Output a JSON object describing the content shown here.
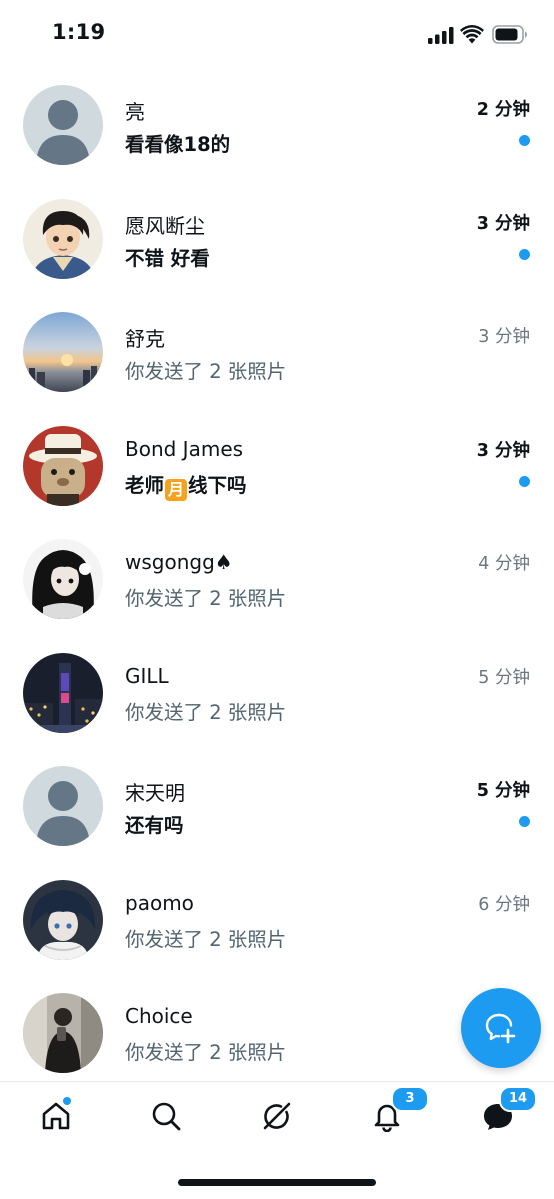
{
  "status_bar": {
    "time": "1:19"
  },
  "conversations": [
    {
      "name": "亮",
      "message": "看看像18的",
      "time": "2 分钟",
      "unread": true,
      "avatar": "default-avatar"
    },
    {
      "name": "愿风断尘",
      "message": "不错 好看",
      "time": "3 分钟",
      "unread": true,
      "avatar": "anime-warrior-avatar"
    },
    {
      "name": "舒克",
      "message": "你发送了 2 张照片",
      "time": "3 分钟",
      "unread": false,
      "avatar": "sunset-city-avatar"
    },
    {
      "name": "Bond James",
      "message_pre": "老师",
      "message_emoji": "月",
      "message_post": "线下吗",
      "time": "3 分钟",
      "unread": true,
      "avatar": "cartoon-hat-avatar"
    },
    {
      "name": "wsgongg♠",
      "message": "你发送了 2 张照片",
      "time": "4 分钟",
      "unread": false,
      "avatar": "anime-girl-avatar"
    },
    {
      "name": "GILL",
      "message": "你发送了 2 张照片",
      "time": "5 分钟",
      "unread": false,
      "avatar": "night-city-avatar"
    },
    {
      "name": "宋天明",
      "message": "还有吗",
      "time": "5 分钟",
      "unread": true,
      "avatar": "default-avatar"
    },
    {
      "name": "paomo",
      "message": "你发送了 2 张照片",
      "time": "6 分钟",
      "unread": false,
      "avatar": "anime-boy-avatar"
    },
    {
      "name": "Choice",
      "message": "你发送了 2 张照片",
      "time": "",
      "unread": false,
      "avatar": "mirror-selfie-avatar"
    }
  ],
  "fab": {
    "icon": "compose-message-icon"
  },
  "tab_bar": {
    "home": {
      "icon": "home-icon",
      "has_dot": true
    },
    "search": {
      "icon": "search-icon"
    },
    "grok": {
      "icon": "grok-icon"
    },
    "notifications": {
      "icon": "bell-icon",
      "badge": "3"
    },
    "messages": {
      "icon": "messages-icon",
      "badge": "14"
    }
  },
  "colors": {
    "accent": "#1d9bf0",
    "text": "#0f1419",
    "secondary": "#536471"
  }
}
